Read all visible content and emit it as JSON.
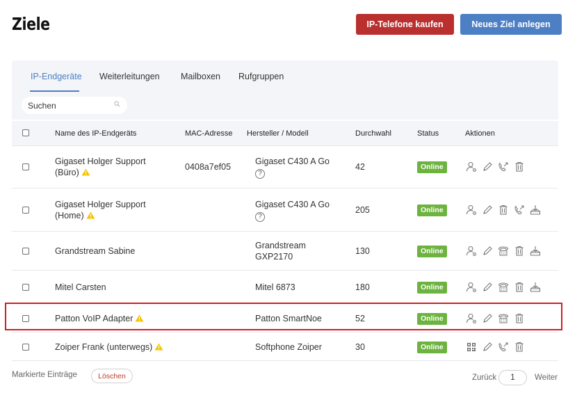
{
  "header": {
    "title": "Ziele",
    "buy_button": "IP-Telefone kaufen",
    "new_button": "Neues Ziel anlegen",
    "buy_color": "#b9302f",
    "new_color": "#4c7fc4"
  },
  "tabs": [
    "IP-Endgeräte",
    "Weiterleitungen",
    "Mailboxen",
    "Rufgruppen"
  ],
  "active_tab": "IP-Endgeräte",
  "search": {
    "placeholder": "Suchen"
  },
  "table": {
    "columns": [
      "Name des IP-Endgeräts",
      "MAC-Adresse",
      "Hersteller / Modell",
      "Durchwahl",
      "Status",
      "Aktionen"
    ],
    "rows": [
      {
        "name_line1": "Gigaset Holger Support",
        "name_line2": "(Büro)",
        "warning": true,
        "mac": "0408a7ef05",
        "model_line1": "Gigaset C430 A Go",
        "model_help": true,
        "extension": "42",
        "status": "Online",
        "actions": [
          "user-settings-icon",
          "edit-icon",
          "call-forward-icon",
          "trash-icon"
        ]
      },
      {
        "name_line1": "Gigaset Holger Support",
        "name_line2": "(Home)",
        "warning": true,
        "mac": "",
        "model_line1": "Gigaset C430 A Go",
        "model_help": true,
        "extension": "205",
        "status": "Online",
        "actions": [
          "user-settings-icon",
          "edit-icon",
          "trash-icon",
          "call-forward-icon",
          "provision-icon"
        ]
      },
      {
        "name_line1": "Grandstream Sabine",
        "name_line2": "",
        "warning": false,
        "mac": "",
        "model_line1": "Grandstream",
        "model_line2": "GXP2170",
        "model_help": false,
        "extension": "130",
        "status": "Online",
        "actions": [
          "user-settings-icon",
          "edit-icon",
          "desk-phone-icon",
          "trash-icon",
          "provision-icon"
        ]
      },
      {
        "name_line1": "Mitel Carsten",
        "name_line2": "",
        "warning": false,
        "mac": "",
        "model_line1": "Mitel 6873",
        "model_help": false,
        "extension": "180",
        "status": "Online",
        "actions": [
          "user-settings-icon",
          "edit-icon",
          "desk-phone-icon",
          "trash-icon",
          "provision-icon"
        ]
      },
      {
        "name_line1": "Patton VoIP Adapter",
        "name_line2": "",
        "warning": true,
        "mac": "",
        "model_line1": "Patton SmartNoe",
        "model_help": false,
        "extension": "52",
        "status": "Online",
        "actions": [
          "user-settings-icon",
          "edit-icon",
          "desk-phone-icon",
          "trash-icon"
        ]
      },
      {
        "name_line1": "Zoiper Frank (unterwegs)",
        "name_line2": "",
        "warning": true,
        "mac": "",
        "model_line1": "Softphone Zoiper",
        "model_help": false,
        "extension": "30",
        "status": "Online",
        "actions": [
          "qr-code-icon",
          "edit-icon",
          "call-forward-icon",
          "trash-icon"
        ]
      }
    ]
  },
  "footer": {
    "marked": "Markierte Einträge",
    "delete": "Löschen",
    "back": "Zurück",
    "page": "1",
    "next": "Weiter"
  },
  "colors": {
    "online": "#6db33f",
    "highlight": "#cc1f26",
    "warning": "#f5c400"
  }
}
